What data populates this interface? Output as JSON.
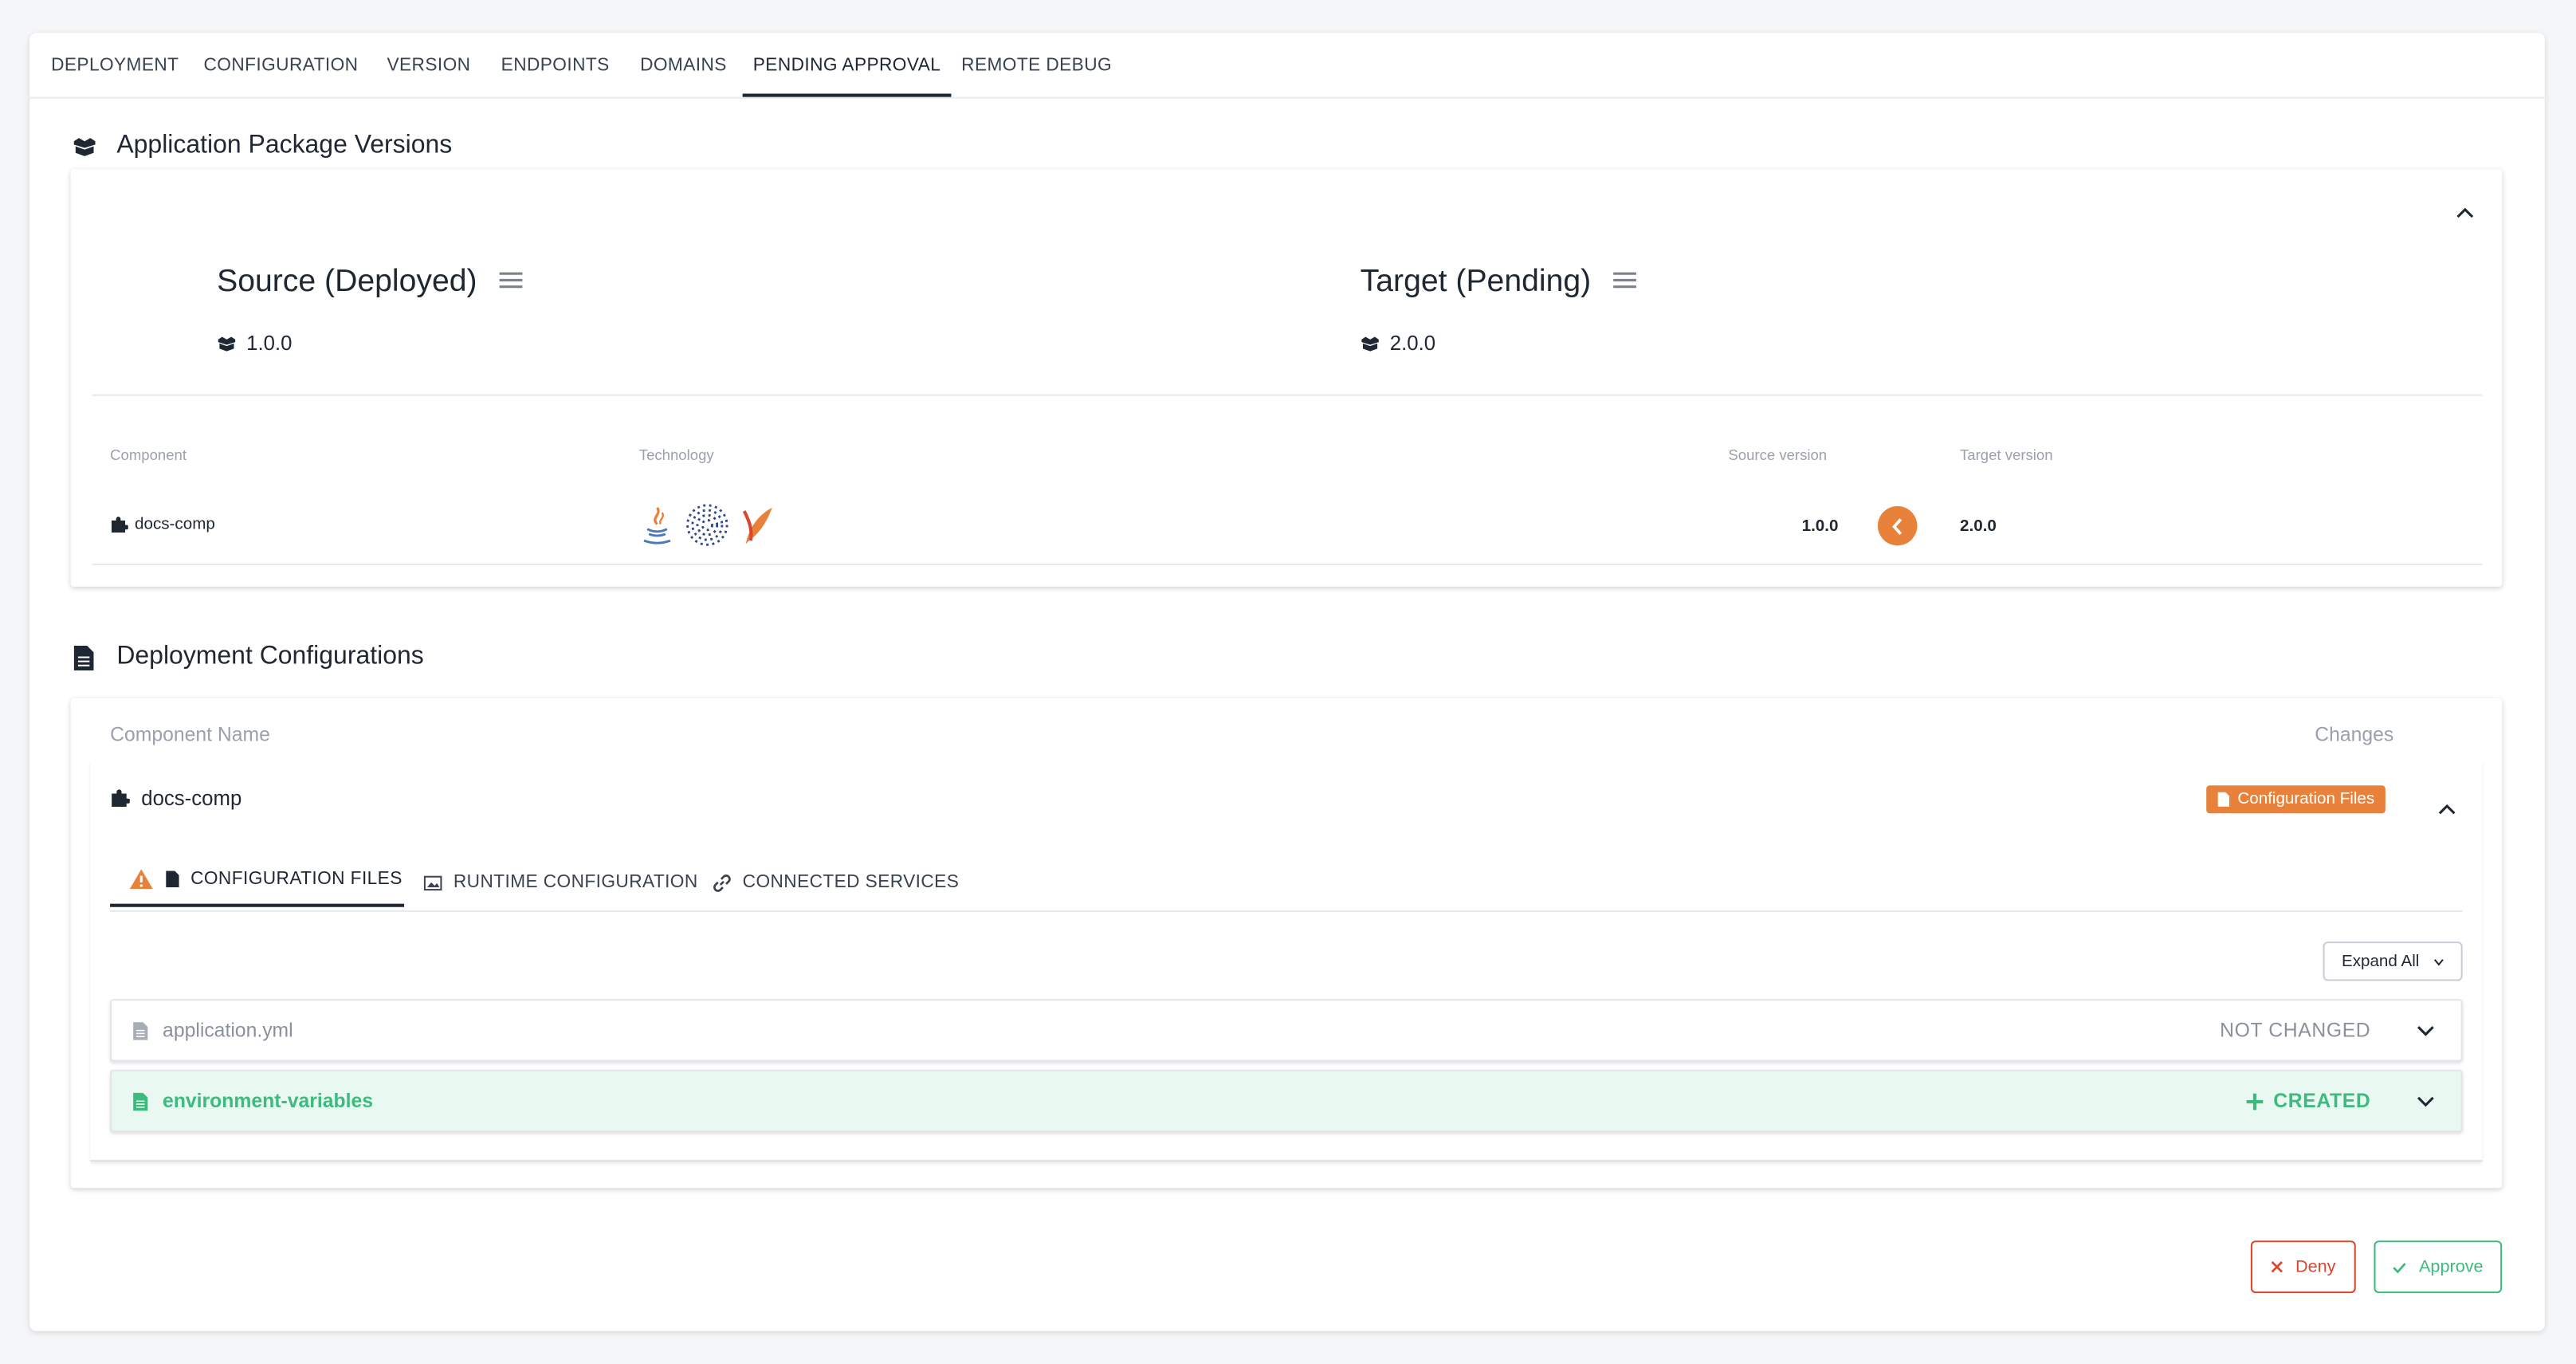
{
  "tabs": [
    {
      "label": "DEPLOYMENT"
    },
    {
      "label": "CONFIGURATION"
    },
    {
      "label": "VERSION"
    },
    {
      "label": "ENDPOINTS"
    },
    {
      "label": "DOMAINS"
    },
    {
      "label": "PENDING APPROVAL",
      "active": true
    },
    {
      "label": "REMOTE DEBUG"
    }
  ],
  "package_versions": {
    "title": "Application Package Versions",
    "icon": "boxes-icon",
    "source": {
      "title": "Source (Deployed)",
      "version": "1.0.0"
    },
    "target": {
      "title": "Target (Pending)",
      "version": "2.0.0"
    },
    "columns": {
      "component": "Component",
      "technology": "Technology",
      "source_version": "Source version",
      "target_version": "Target version"
    },
    "row": {
      "component": "docs-comp",
      "technologies": [
        "java-icon",
        "spring-dots-icon",
        "apache-feather-icon"
      ],
      "source_version": "1.0.0",
      "target_version": "2.0.0"
    }
  },
  "deployment_configs": {
    "title": "Deployment Configurations",
    "icon": "file-icon",
    "columns": {
      "component_name": "Component Name",
      "changes": "Changes"
    },
    "component": {
      "name": "docs-comp",
      "badge": "Configuration Files",
      "subtabs": [
        {
          "label": "CONFIGURATION FILES",
          "active": true,
          "warning": true
        },
        {
          "label": "RUNTIME CONFIGURATION"
        },
        {
          "label": "CONNECTED SERVICES"
        }
      ],
      "expand_all": "Expand All",
      "files": [
        {
          "name": "application.yml",
          "status": "NOT CHANGED"
        },
        {
          "name": "environment-variables",
          "status": "CREATED"
        }
      ]
    }
  },
  "actions": {
    "deny": "Deny",
    "approve": "Approve"
  },
  "colors": {
    "accent_orange": "#e8823a",
    "created_green": "#3dbb7e",
    "created_bg": "#e9f8f1",
    "deny_red": "#d9472f",
    "dark": "#1f2733"
  }
}
